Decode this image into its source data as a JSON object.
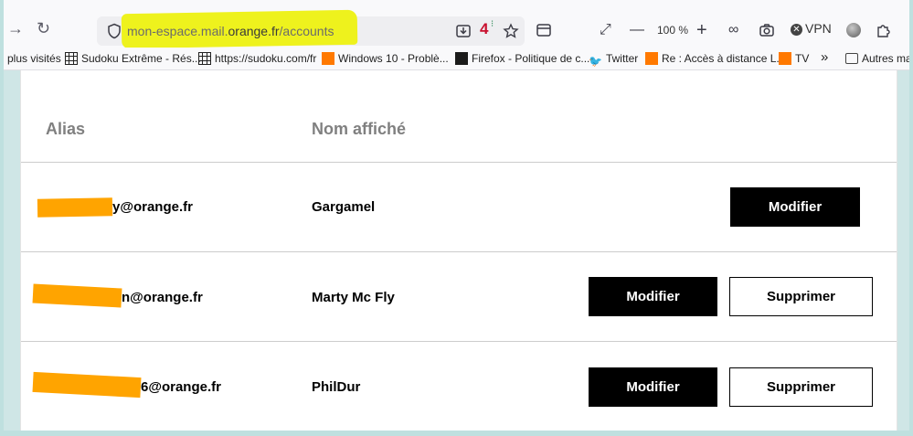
{
  "toolbar": {
    "url_host": "mon-espace.mail.",
    "url_domain": "orange.fr",
    "url_path": "/accounts",
    "zoom": "100 %",
    "vpn_label": "VPN",
    "badge_number": "4"
  },
  "bookmarks": [
    {
      "label": "plus visités",
      "icon": ""
    },
    {
      "label": "Sudoku Extrême - Rés...",
      "icon": "grid"
    },
    {
      "label": "https://sudoku.com/fr",
      "icon": "grid"
    },
    {
      "label": "Windows 10 - Problè...",
      "icon": "orange"
    },
    {
      "label": "Firefox - Politique de c...",
      "icon": "terminal"
    },
    {
      "label": "Twitter",
      "icon": "twitter-bird"
    },
    {
      "label": "Re : Accès à distance L...",
      "icon": "orange"
    },
    {
      "label": "TV",
      "icon": "orange"
    },
    {
      "label": "Autres ma",
      "icon": "folder"
    }
  ],
  "table": {
    "headers": {
      "alias": "Alias",
      "display_name": "Nom affiché"
    },
    "rows": [
      {
        "alias_suffix": "y@orange.fr",
        "name": "Gargamel",
        "modify": "Modifier",
        "delete": ""
      },
      {
        "alias_suffix": "n@orange.fr",
        "name": "Marty Mc Fly",
        "modify": "Modifier",
        "delete": "Supprimer"
      },
      {
        "alias_suffix": "6@orange.fr",
        "name": "PhilDur",
        "modify": "Modifier",
        "delete": "Supprimer"
      }
    ]
  },
  "colors": {
    "highlight": "#eef21d",
    "redaction": "#ffa400",
    "orange_brand": "#ff7900"
  }
}
